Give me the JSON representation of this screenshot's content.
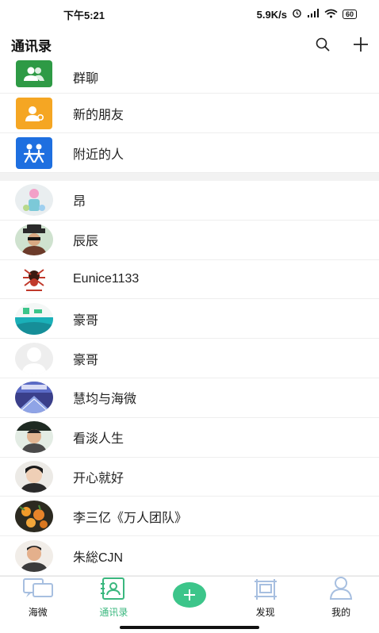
{
  "status_bar": {
    "time": "下午5:21",
    "speed": "5.9K/s",
    "battery": "60"
  },
  "header": {
    "title": "通讯录",
    "search_icon": "search-icon",
    "add_icon": "plus-icon"
  },
  "functions": [
    {
      "label": "群聊",
      "icon": "group-icon",
      "color": "#2e9a45"
    },
    {
      "label": "新的朋友",
      "icon": "new-friend-icon",
      "color": "#f5a623"
    },
    {
      "label": "附近的人",
      "icon": "nearby-people-icon",
      "color": "#1e6fe0"
    }
  ],
  "contacts": [
    {
      "name": "昂"
    },
    {
      "name": "辰辰"
    },
    {
      "name": "Eunice1133"
    },
    {
      "name": "豪哥"
    },
    {
      "name": "豪哥"
    },
    {
      "name": "慧均与海微"
    },
    {
      "name": "看淡人生"
    },
    {
      "name": "开心就好"
    },
    {
      "name": "李三亿《万人团队》"
    },
    {
      "name": "朱総CJN"
    }
  ],
  "tabs": [
    {
      "label": "海微",
      "icon": "chat-icon"
    },
    {
      "label": "通讯录",
      "icon": "contacts-icon",
      "active": true
    },
    {
      "label": "",
      "icon": "plus-icon"
    },
    {
      "label": "发现",
      "icon": "discover-icon"
    },
    {
      "label": "我的",
      "icon": "profile-icon"
    }
  ],
  "colors": {
    "accent": "#3ab77e",
    "plus_button": "#3cc58a"
  }
}
